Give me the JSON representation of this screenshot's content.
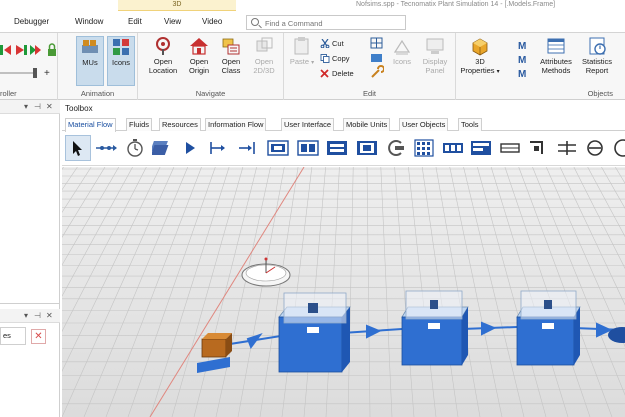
{
  "window": {
    "context_tab": "3D",
    "title": "Nofsims.spp - Tecnomatix Plant Simulation 14 - [.Models.Frame]"
  },
  "menu": {
    "items": [
      "Debugger",
      "Window",
      "Edit",
      "View",
      "Video"
    ],
    "search_placeholder": "Find a Command"
  },
  "ribbon": {
    "groups": {
      "controller": "roller",
      "animation": "Animation",
      "navigate": "Navigate",
      "edit": "Edit",
      "objects": "Objects"
    },
    "buttons": {
      "mus": "MUs",
      "icons": "Icons",
      "open_location": [
        "Open",
        "Location"
      ],
      "open_origin": [
        "Open",
        "Origin"
      ],
      "open_class": [
        "Open",
        "Class"
      ],
      "open_2d3d": [
        "Open",
        "2D/3D"
      ],
      "paste": "Paste",
      "cut": "Cut",
      "copy": "Copy",
      "delete": "Delete",
      "icons_disabled": "Icons",
      "display_panel": [
        "Display",
        "Panel"
      ],
      "properties_3d": [
        "3D",
        "Properties"
      ],
      "attributes_methods": [
        "Attributes",
        "Methods"
      ],
      "statistics_report": [
        "Statistics",
        "Report"
      ]
    }
  },
  "toolbox": {
    "title": "Toolbox",
    "tabs": [
      "Material Flow",
      "Fluids",
      "Resources",
      "Information Flow",
      "User Interface",
      "Mobile Units",
      "User Objects",
      "Tools"
    ],
    "active_tab": "Material Flow"
  },
  "left_panel": {
    "stub_text": "es"
  },
  "colors": {
    "accent": "#1f6fbf",
    "station_blue": "#2f6fd1",
    "grid_line": "#c6c6c6",
    "floor": "#e6e6e6"
  }
}
